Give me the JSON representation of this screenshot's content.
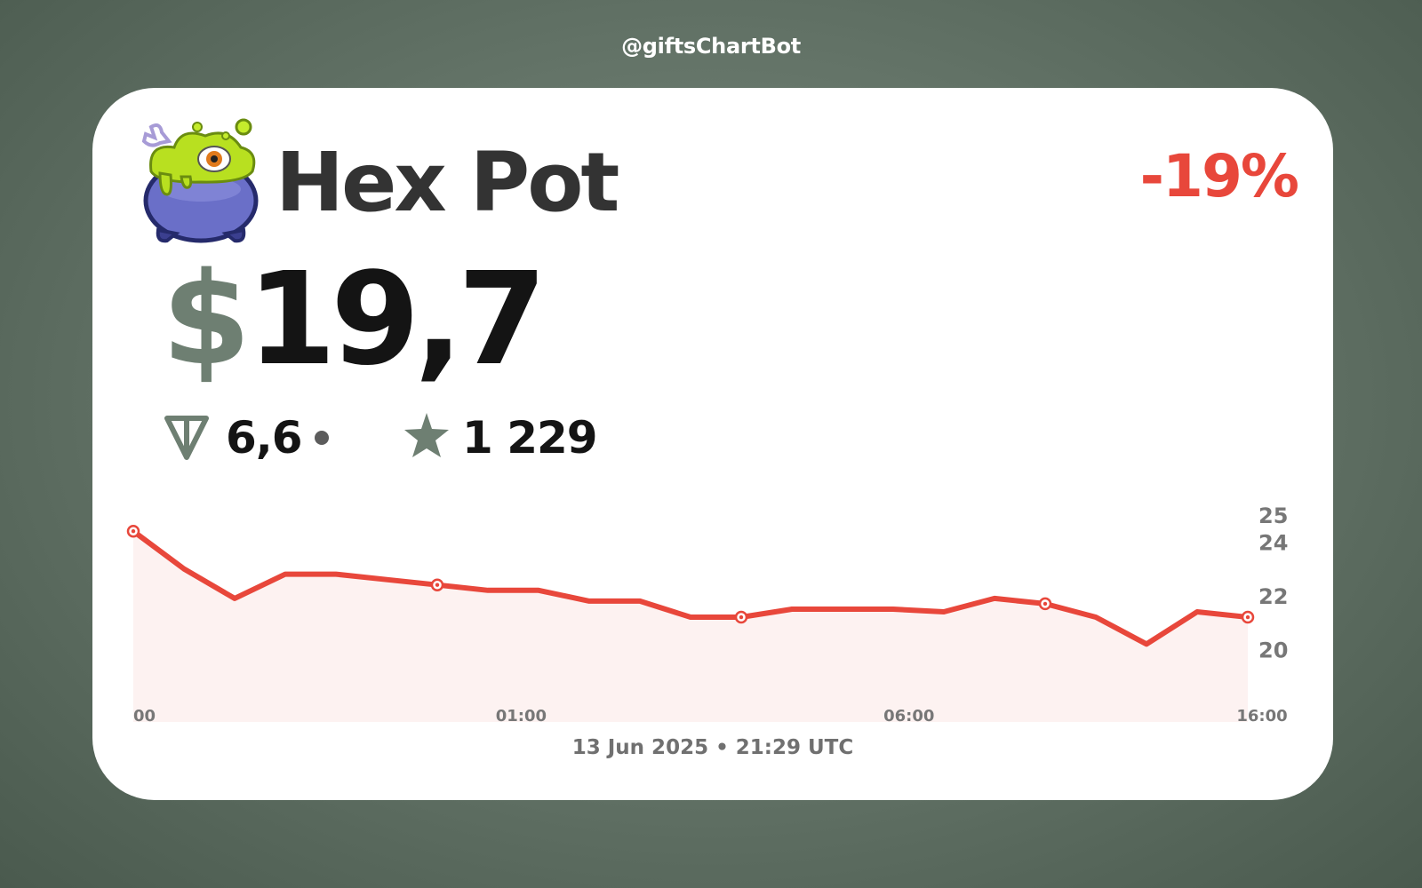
{
  "header": {
    "bot_handle": "@giftsChartBot"
  },
  "gift": {
    "name": "Hex Pot",
    "icon": "hex-pot-cauldron-icon",
    "change_percent": "-19%",
    "price_currency_symbol": "$",
    "price_usd": "19,7",
    "price_ton": "6,6",
    "price_stars": "1 229"
  },
  "colors": {
    "accent_red": "#e8473b",
    "muted_green": "#6e7f72",
    "text_dark": "#141414",
    "line_fill": "#fdf2f1"
  },
  "chart_data": {
    "type": "area",
    "x_tick_labels": [
      "00",
      "01:00",
      "06:00",
      "16:00"
    ],
    "y_tick_labels": [
      "25",
      "24",
      "22",
      "20"
    ],
    "ylim": [
      17.3,
      25.3
    ],
    "values": [
      24.4,
      23.0,
      21.9,
      22.8,
      22.8,
      22.6,
      22.4,
      22.2,
      22.2,
      21.8,
      21.8,
      21.2,
      21.2,
      21.5,
      21.5,
      21.5,
      21.4,
      21.9,
      21.7,
      21.2,
      20.2,
      21.4,
      21.2
    ],
    "markers": [
      0,
      6,
      12,
      18,
      22
    ],
    "grid": false,
    "legend": "none"
  },
  "footer": {
    "date_text": "13 Jun 2025 • 21:29 UTC"
  }
}
